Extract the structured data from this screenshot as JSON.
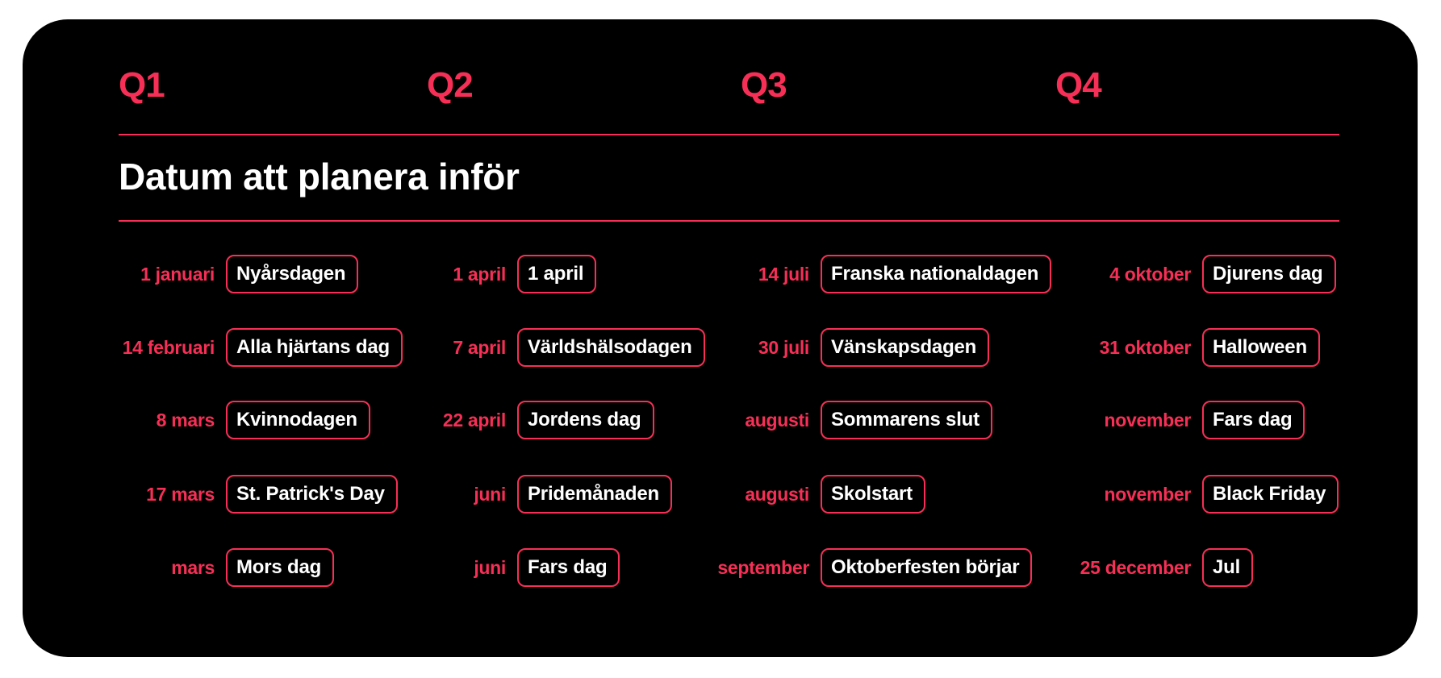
{
  "colors": {
    "background": "#000000",
    "accent": "#F72F56",
    "text": "#FFFFFF"
  },
  "title": "Datum att planera inför",
  "quarters": [
    {
      "label": "Q1",
      "items": [
        {
          "date": "1 januari",
          "event": "Nyårsdagen"
        },
        {
          "date": "14 februari",
          "event": "Alla hjärtans dag"
        },
        {
          "date": "8 mars",
          "event": "Kvinnodagen"
        },
        {
          "date": "17 mars",
          "event": "St. Patrick's Day"
        },
        {
          "date": "mars",
          "event": "Mors dag"
        }
      ]
    },
    {
      "label": "Q2",
      "items": [
        {
          "date": "1 april",
          "event": "1 april"
        },
        {
          "date": "7 april",
          "event": "Världshälsodagen"
        },
        {
          "date": "22 april",
          "event": "Jordens dag"
        },
        {
          "date": "juni",
          "event": "Pridemånaden"
        },
        {
          "date": "juni",
          "event": "Fars dag"
        }
      ]
    },
    {
      "label": "Q3",
      "items": [
        {
          "date": "14 juli",
          "event": "Franska nationaldagen"
        },
        {
          "date": "30 juli",
          "event": "Vänskapsdagen"
        },
        {
          "date": "augusti",
          "event": "Sommarens slut"
        },
        {
          "date": "augusti",
          "event": "Skolstart"
        },
        {
          "date": "september",
          "event": "Oktoberfesten börjar"
        }
      ]
    },
    {
      "label": "Q4",
      "items": [
        {
          "date": "4 oktober",
          "event": "Djurens dag"
        },
        {
          "date": "31 oktober",
          "event": "Halloween"
        },
        {
          "date": "november",
          "event": "Fars dag"
        },
        {
          "date": "november",
          "event": "Black Friday"
        },
        {
          "date": "25 december",
          "event": "Jul"
        }
      ]
    }
  ]
}
